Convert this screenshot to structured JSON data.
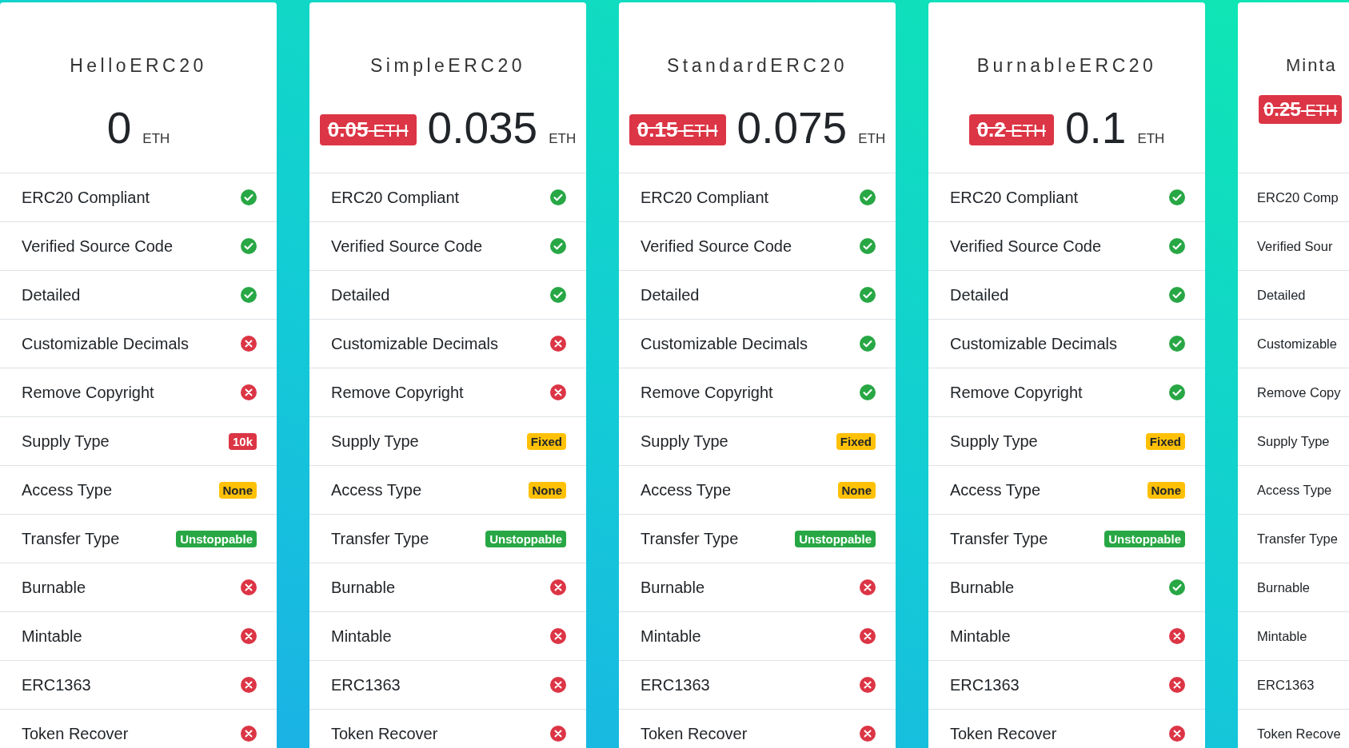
{
  "cards": [
    {
      "kind": "full",
      "title": "HelloERC20",
      "price": "0",
      "unit": "ETH",
      "features": [
        {
          "label": "ERC20 Compliant",
          "kind": "check",
          "on": true
        },
        {
          "label": "Verified Source Code",
          "kind": "check",
          "on": true
        },
        {
          "label": "Detailed",
          "kind": "check",
          "on": true
        },
        {
          "label": "Customizable Decimals",
          "kind": "check",
          "on": false
        },
        {
          "label": "Remove Copyright",
          "kind": "check",
          "on": false
        },
        {
          "label": "Supply Type",
          "kind": "badge",
          "value": "10k",
          "color": "#dc3545"
        },
        {
          "label": "Access Type",
          "kind": "badge",
          "value": "None",
          "color": "#ffc107"
        },
        {
          "label": "Transfer Type",
          "kind": "badge",
          "value": "Unstoppable",
          "color": "#28a745"
        },
        {
          "label": "Burnable",
          "kind": "check",
          "on": false
        },
        {
          "label": "Mintable",
          "kind": "check",
          "on": false
        },
        {
          "label": "ERC1363",
          "kind": "check",
          "on": false
        },
        {
          "label": "Token Recover",
          "kind": "check",
          "on": false
        }
      ]
    },
    {
      "kind": "full",
      "title": "SimpleERC20",
      "old_price": {
        "amount": "0.05",
        "unit": "ETH"
      },
      "price": "0.035",
      "unit": "ETH",
      "features": [
        {
          "label": "ERC20 Compliant",
          "kind": "check",
          "on": true
        },
        {
          "label": "Verified Source Code",
          "kind": "check",
          "on": true
        },
        {
          "label": "Detailed",
          "kind": "check",
          "on": true
        },
        {
          "label": "Customizable Decimals",
          "kind": "check",
          "on": false
        },
        {
          "label": "Remove Copyright",
          "kind": "check",
          "on": false
        },
        {
          "label": "Supply Type",
          "kind": "badge",
          "value": "Fixed",
          "color": "#ffc107"
        },
        {
          "label": "Access Type",
          "kind": "badge",
          "value": "None",
          "color": "#ffc107"
        },
        {
          "label": "Transfer Type",
          "kind": "badge",
          "value": "Unstoppable",
          "color": "#28a745"
        },
        {
          "label": "Burnable",
          "kind": "check",
          "on": false
        },
        {
          "label": "Mintable",
          "kind": "check",
          "on": false
        },
        {
          "label": "ERC1363",
          "kind": "check",
          "on": false
        },
        {
          "label": "Token Recover",
          "kind": "check",
          "on": false
        }
      ]
    },
    {
      "kind": "full",
      "title": "StandardERC20",
      "old_price": {
        "amount": "0.15",
        "unit": "ETH"
      },
      "price": "0.075",
      "unit": "ETH",
      "features": [
        {
          "label": "ERC20 Compliant",
          "kind": "check",
          "on": true
        },
        {
          "label": "Verified Source Code",
          "kind": "check",
          "on": true
        },
        {
          "label": "Detailed",
          "kind": "check",
          "on": true
        },
        {
          "label": "Customizable Decimals",
          "kind": "check",
          "on": true
        },
        {
          "label": "Remove Copyright",
          "kind": "check",
          "on": true
        },
        {
          "label": "Supply Type",
          "kind": "badge",
          "value": "Fixed",
          "color": "#ffc107"
        },
        {
          "label": "Access Type",
          "kind": "badge",
          "value": "None",
          "color": "#ffc107"
        },
        {
          "label": "Transfer Type",
          "kind": "badge",
          "value": "Unstoppable",
          "color": "#28a745"
        },
        {
          "label": "Burnable",
          "kind": "check",
          "on": false
        },
        {
          "label": "Mintable",
          "kind": "check",
          "on": false
        },
        {
          "label": "ERC1363",
          "kind": "check",
          "on": false
        },
        {
          "label": "Token Recover",
          "kind": "check",
          "on": false
        }
      ]
    },
    {
      "kind": "full",
      "title": "BurnableERC20",
      "old_price": {
        "amount": "0.2",
        "unit": "ETH"
      },
      "price": "0.1",
      "unit": "ETH",
      "features": [
        {
          "label": "ERC20 Compliant",
          "kind": "check",
          "on": true
        },
        {
          "label": "Verified Source Code",
          "kind": "check",
          "on": true
        },
        {
          "label": "Detailed",
          "kind": "check",
          "on": true
        },
        {
          "label": "Customizable Decimals",
          "kind": "check",
          "on": true
        },
        {
          "label": "Remove Copyright",
          "kind": "check",
          "on": true
        },
        {
          "label": "Supply Type",
          "kind": "badge",
          "value": "Fixed",
          "color": "#ffc107"
        },
        {
          "label": "Access Type",
          "kind": "badge",
          "value": "None",
          "color": "#ffc107"
        },
        {
          "label": "Transfer Type",
          "kind": "badge",
          "value": "Unstoppable",
          "color": "#28a745"
        },
        {
          "label": "Burnable",
          "kind": "check",
          "on": true
        },
        {
          "label": "Mintable",
          "kind": "check",
          "on": false
        },
        {
          "label": "ERC1363",
          "kind": "check",
          "on": false
        },
        {
          "label": "Token Recover",
          "kind": "check",
          "on": false
        }
      ]
    },
    {
      "kind": "partial",
      "title": "Minta",
      "old_price": {
        "amount": "0.25",
        "unit": "ETH"
      },
      "features": [
        {
          "label": "ERC20 Comp"
        },
        {
          "label": "Verified Sour"
        },
        {
          "label": "Detailed"
        },
        {
          "label": "Customizable"
        },
        {
          "label": "Remove Copy"
        },
        {
          "label": "Supply Type"
        },
        {
          "label": "Access Type"
        },
        {
          "label": "Transfer Type"
        },
        {
          "label": "Burnable"
        },
        {
          "label": "Mintable"
        },
        {
          "label": "ERC1363"
        },
        {
          "label": "Token Recove"
        }
      ]
    }
  ]
}
